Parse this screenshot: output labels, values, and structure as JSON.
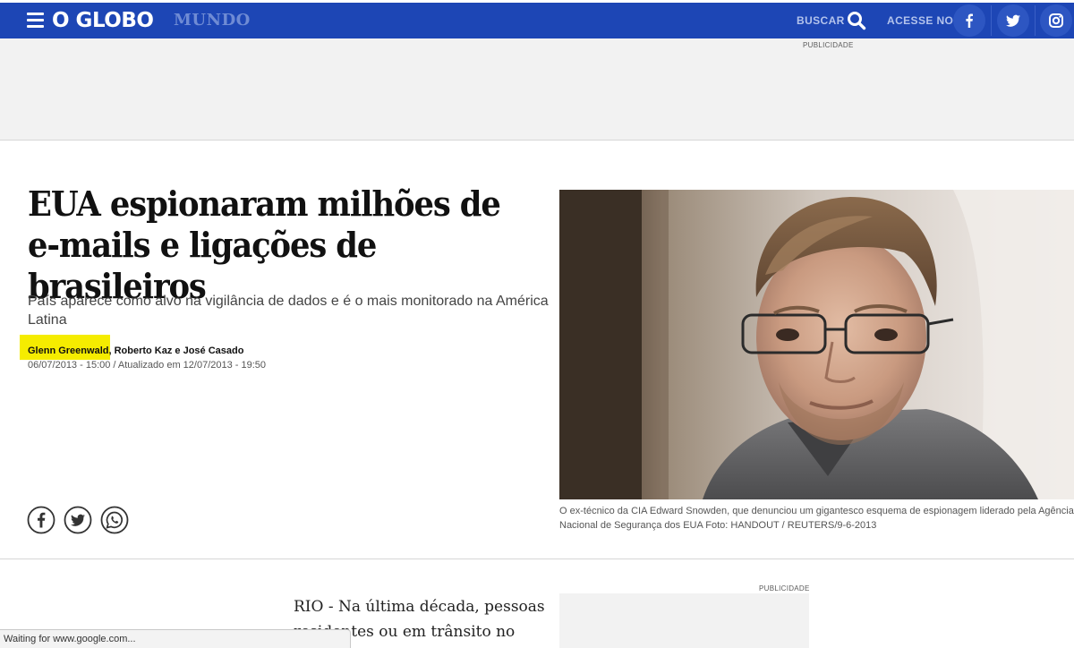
{
  "header": {
    "logo": "O GLOBO",
    "section": "MUNDO",
    "search_label": "BUSCAR",
    "access_label": "ACESSE NO",
    "social": [
      "facebook-icon",
      "twitter-icon",
      "instagram-icon"
    ],
    "brand_color": "#1d46b5"
  },
  "ads": {
    "top_label": "PUBLICIDADE",
    "side_label": "PUBLICIDADE"
  },
  "article": {
    "headline": "EUA espionaram milhões de e-mails e ligações de brasileiros",
    "subtitle": "País aparece como alvo na vigilância de dados e é o mais monitorado na América Latina",
    "author_primary": "Glenn Greenwald",
    "authors_rest": ", Roberto Kaz e José Casado",
    "dateline": "06/07/2013 - 15:00 / Atualizado em 12/07/2013 - 19:50",
    "highlight_color": "#f5ec00",
    "share": [
      "facebook-share-icon",
      "twitter-share-icon",
      "whatsapp-share-icon"
    ],
    "photo_caption": "O ex-técnico da CIA Edward Snowden, que denunciou um gigantesco esquema de espionagem liderado pela Agência Nacional de Segurança dos EUA Foto: HANDOUT / REUTERS/9-6-2013",
    "body_lead": "RIO - Na última década, pessoas residentes ou em trânsito no Brasil,"
  },
  "browser": {
    "status_text": "Waiting for www.google.com..."
  }
}
